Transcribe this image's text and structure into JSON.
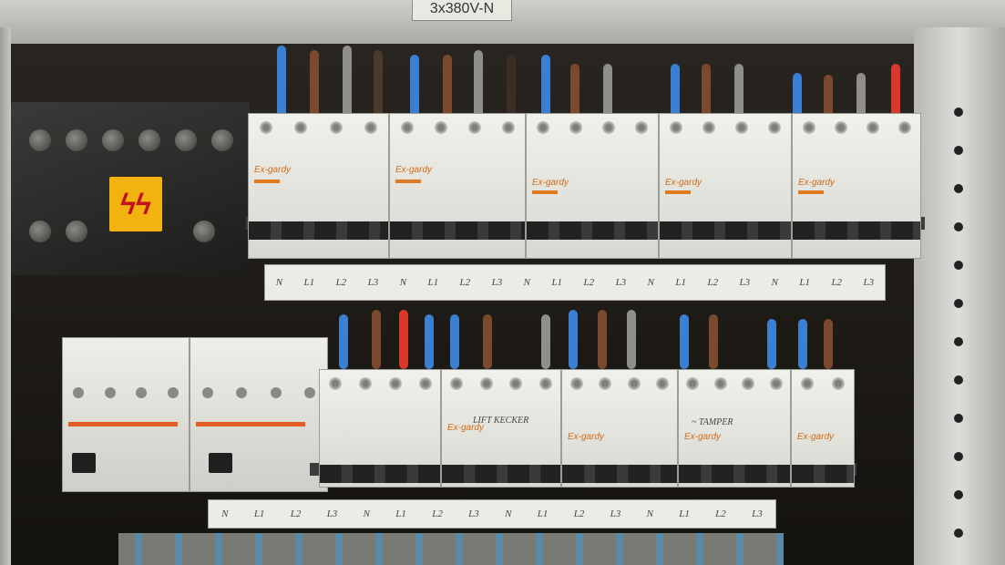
{
  "panel": {
    "voltage_plate": "3x380V-N",
    "warning_symbol": "high-voltage-icon",
    "warning_glyph": "ϟϟ",
    "upper_breakers": {
      "brand": "Ex-gardy",
      "phase_labels": [
        "N",
        "L1",
        "L2",
        "L3",
        "N",
        "L1",
        "L2",
        "L3",
        "N",
        "L1",
        "L2",
        "L3",
        "N",
        "L1",
        "L2",
        "L3",
        "N",
        "L1",
        "L2",
        "L3"
      ]
    },
    "lower_breakers": {
      "brand": "Ex-gardy",
      "handwritten": [
        "LIFT KECKER",
        "~ TAMPER"
      ],
      "phase_labels": [
        "N",
        "L1",
        "L2",
        "L3",
        "N",
        "L1",
        "L2",
        "L3",
        "N",
        "L1",
        "L2",
        "L3",
        "N",
        "L1",
        "L2",
        "L3"
      ]
    },
    "colors": {
      "wire_blue": "#3b7fd1",
      "wire_brown": "#7b4a2c",
      "wire_grey": "#8e8e8a",
      "wire_red": "#d9392d",
      "warning_yellow": "#f2b311",
      "brand_orange": "#d26a15"
    }
  }
}
